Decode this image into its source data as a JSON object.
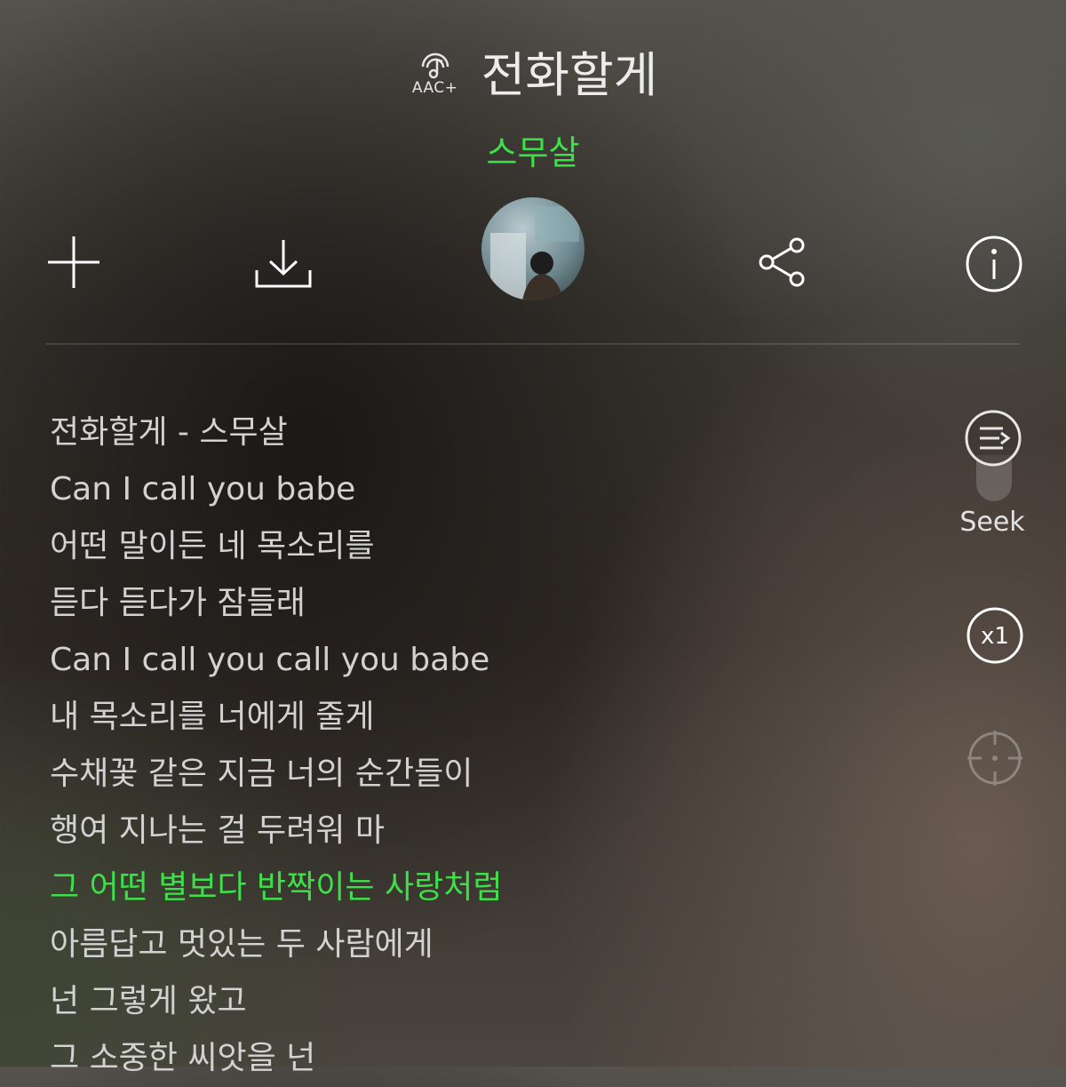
{
  "header": {
    "quality_badge": "AAC+",
    "title": "전화할게",
    "artist": "스무살"
  },
  "actions": {
    "add": "add-icon",
    "download": "download-icon",
    "album_art": "album-art",
    "share": "share-icon",
    "info": "info-icon"
  },
  "side_controls": {
    "seek_label": "Seek",
    "speed_label": "x1"
  },
  "lyrics": [
    "전화할게 - 스무살",
    "Can I call you babe",
    "어떤 말이든 네 목소리를",
    "듣다 듣다가 잠들래",
    "Can I call you call you babe",
    "내 목소리를 너에게 줄게",
    "수채꽃 같은 지금 너의 순간들이",
    "행여 지나는 걸 두려워 마",
    "그 어떤 별보다 반짝이는 사랑처럼",
    "아름답고 멋있는 두 사람에게",
    "넌 그렇게 왔고",
    "그 소중한 씨앗을 넌"
  ],
  "active_lyric_index": 8,
  "colors": {
    "accent": "#3ee04a",
    "text": "#d2d2d2"
  }
}
